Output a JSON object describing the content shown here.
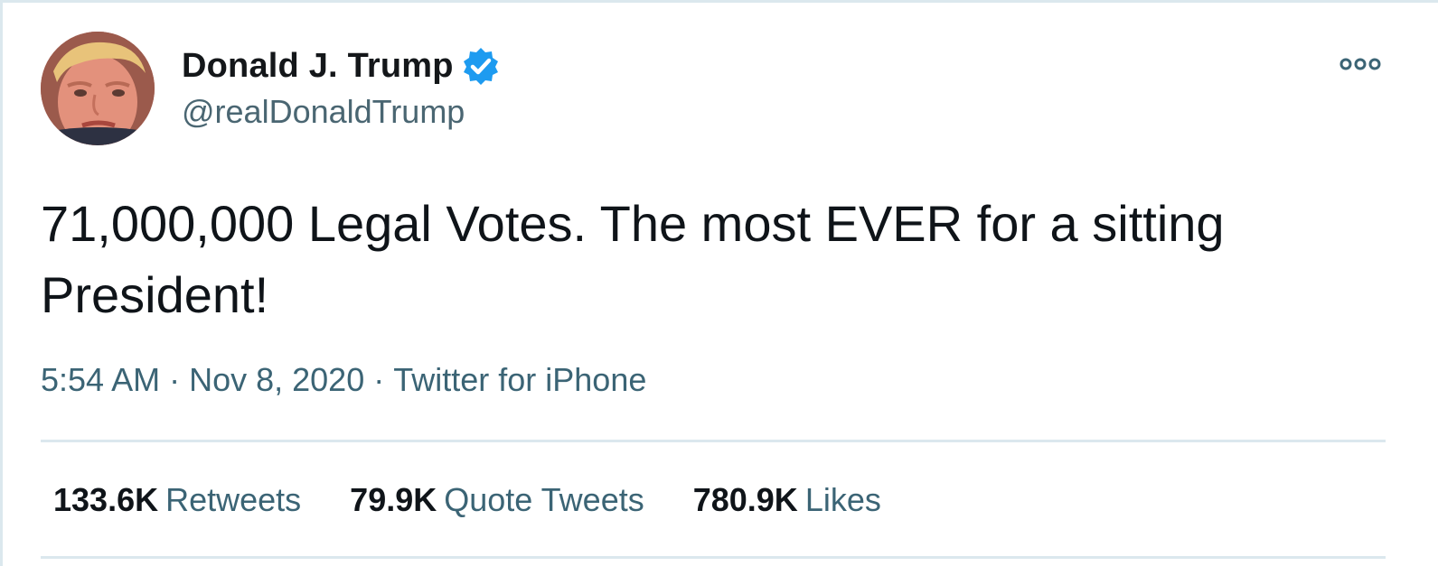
{
  "author": {
    "display_name": "Donald J. Trump",
    "handle": "@realDonaldTrump",
    "verified_icon": "verified-badge-icon"
  },
  "tweet": {
    "text": "71,000,000 Legal Votes. The most EVER for a sitting President!",
    "time": "5:54 AM",
    "separator": "·",
    "date": "Nov 8, 2020",
    "source": "Twitter for iPhone"
  },
  "stats": [
    {
      "count": "133.6K",
      "label": "Retweets"
    },
    {
      "count": "79.9K",
      "label": "Quote Tweets"
    },
    {
      "count": "780.9K",
      "label": "Likes"
    }
  ],
  "colors": {
    "accent": "#1da1f2",
    "text": "#0f1419",
    "secondary": "#3b6475",
    "divider": "#dbe8ee"
  },
  "icons": {
    "more": "more-options-icon",
    "avatar": "avatar"
  }
}
